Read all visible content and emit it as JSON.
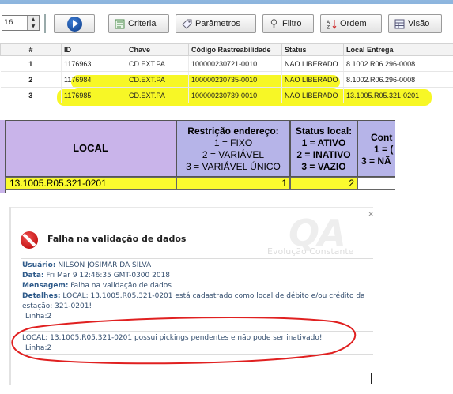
{
  "toolbar": {
    "spin_value": "16",
    "buttons": [
      {
        "label": "Criteria",
        "icon": "criteria-icon"
      },
      {
        "label": "Parâmetros",
        "icon": "tag-icon"
      },
      {
        "label": "Filtro",
        "icon": "filter-icon"
      },
      {
        "label": "Ordem",
        "icon": "sort-az-icon"
      },
      {
        "label": "Visão",
        "icon": "grid-view-icon"
      }
    ]
  },
  "top_table": {
    "headers": [
      "#",
      "ID",
      "Chave",
      "Código Rastreabilidade",
      "Status",
      "Local Entrega"
    ],
    "rows": [
      [
        "1",
        "1176963",
        "CD.EXT.PA",
        "100000230721-0010",
        "NAO LIBERADO",
        "8.1002.R06.296-0008"
      ],
      [
        "2",
        "1176984",
        "CD.EXT.PA",
        "100000230735-0010",
        "NAO LIBERADO",
        "8.1002.R06.296-0008"
      ],
      [
        "3",
        "1176985",
        "CD.EXT.PA",
        "100000230739-0010",
        "NAO LIBERADO",
        "13.1005.R05.321-0201"
      ]
    ]
  },
  "sheet": {
    "local_header": "LOCAL",
    "restricao_lines": [
      "Restrição endereço:",
      "1 = FIXO",
      "2 = VARIÁVEL",
      "3 = VARIÁVEL ÚNICO"
    ],
    "status_lines": [
      "Status local:",
      "1 = ATIVO",
      "2 = INATIVO",
      "3 = VAZIO"
    ],
    "cont_lines": [
      "Cont",
      "1 = (",
      "3 = NÃ"
    ],
    "row": {
      "local": "13.1005.R05.321-0201",
      "restricao": "1",
      "status": "2"
    }
  },
  "dialog": {
    "title": "Falha na validação de dados",
    "logo": "QA",
    "logo_sub": "Evolução Constante",
    "close_glyph": "×",
    "usuario_label": "Usuário:",
    "usuario": "NILSON JOSIMAR DA SILVA",
    "data_label": "Data:",
    "data": "Fri Mar 9 12:46:35 GMT-0300 2018",
    "mensagem_label": "Mensagem:",
    "mensagem": "Falha na validação de dados",
    "detalhes_label": "Detalhes:",
    "detalhes_1": "LOCAL: 13.1005.R05.321-0201 está cadastrado como local de débito e/ou crédito da",
    "detalhes_2": "estação: 321-0201!",
    "linha_1": "Linha:2",
    "local_msg": "LOCAL: 13.1005.R05.321-0201 possui pickings pendentes e não pode ser inativado!",
    "linha_2": "Linha:2"
  },
  "colors": {
    "highlight": "#f6f600",
    "annotation": "#e02020",
    "sheet_header": "#b6b4e8",
    "sheet_local": "#c9b4ea"
  }
}
